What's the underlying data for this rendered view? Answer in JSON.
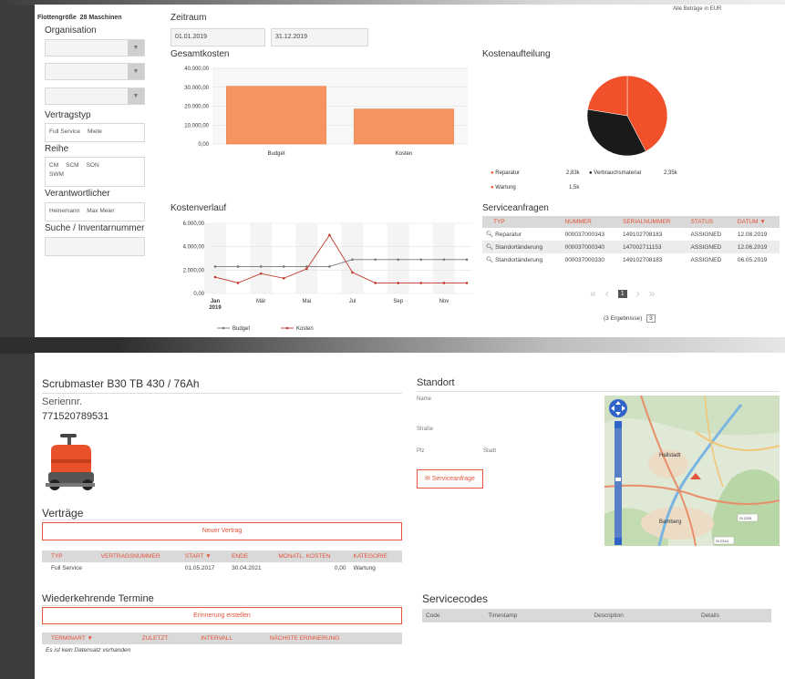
{
  "top": {
    "amounts_note": "Alle Beträge in EUR",
    "fleet_label": "Flottengröße",
    "fleet_count": "28 Maschinen",
    "organisation_label": "Organisation",
    "contract_type_label": "Vertragstyp",
    "contract_types": [
      "Full Service",
      "Miete"
    ],
    "series_label": "Reihe",
    "series": [
      "CM",
      "SCM",
      "SON",
      "SWM"
    ],
    "responsible_label": "Verantwortlicher",
    "responsible": [
      "Heinemann",
      "Max Meier"
    ],
    "search_label": "Suche / Inventarnummer",
    "period_label": "Zeitraum",
    "date_from": "01.01.2019",
    "date_to": "31.12.2019",
    "total_costs_label": "Gesamtkosten",
    "cost_split_label": "Kostenaufteilung",
    "cost_trend_label": "Kostenverlauf",
    "service_requests_label": "Serviceanfragen",
    "pie_legend": [
      {
        "name": "Reparatur",
        "value": "2,83k",
        "color": "#f0502a"
      },
      {
        "name": "Verbrauchsmaterial",
        "value": "2,35k",
        "color": "#111111"
      },
      {
        "name": "Wartung",
        "value": "1,5k",
        "color": "#f0502a"
      }
    ],
    "requests_headers": [
      "TYP",
      "NUMMER",
      "SERIALNUMMER",
      "STATUS",
      "DATUM ▼"
    ],
    "requests_rows": [
      [
        "Reparatur",
        "000037000343",
        "149102708183",
        "ASSIGNED",
        "12.08.2019"
      ],
      [
        "Standortänderung",
        "000037000340",
        "147002711153",
        "ASSIGNED",
        "12.06.2019"
      ],
      [
        "Standortänderung",
        "000037000330",
        "149102708183",
        "ASSIGNED",
        "06.05.2019"
      ]
    ],
    "pager_first": "«",
    "pager_prev": "‹",
    "pager_current": "1",
    "pager_next": "›",
    "pager_last": "»",
    "results_text": "(3 Ergebnisse)",
    "results_per_page": "3"
  },
  "bottom": {
    "machine_title": "Scrubmaster B30 TB 430 / 76Ah",
    "serial_label": "Seriennr.",
    "serial_value": "771520789531",
    "contracts_label": "Verträge",
    "new_contract_button": "Neuer Vertrag",
    "contract_headers": [
      "TYP",
      "VERTRAGSNUMMER",
      "START ▼",
      "ENDE",
      "MONATL. KOSTEN",
      "KATEGORIE"
    ],
    "contract_row": [
      "Full Service",
      "",
      "01.05.2017",
      "30.04.2021",
      "0,00",
      "Wartung"
    ],
    "recurring_label": "Wiederkehrende Termine",
    "reminder_button": "Erinnerung erstellen",
    "recurring_headers": [
      "TERMINART ▼",
      "ZULETZT",
      "INTERVALL",
      "NÄCHSTE ERINNERUNG"
    ],
    "no_records": "Es ist kein Datensatz vorhanden",
    "location_label": "Standort",
    "name_label": "Name",
    "street_label": "Straße",
    "zip_label": "Plz",
    "city_label": "Stadt",
    "service_request_button": "Serviceanfrage",
    "service_codes_label": "Servicecodes",
    "codes_headers": [
      "Code",
      "Timestamp",
      "Description",
      "Details"
    ],
    "map_labels": {
      "hallstadt": "Hallstadt",
      "bamberg": "Bamberg",
      "road1": "St 2281",
      "road2": "St 2244"
    }
  },
  "chart_data": [
    {
      "type": "bar",
      "title": "Gesamtkosten",
      "categories": [
        "Budget",
        "Kosten"
      ],
      "values": [
        30500,
        18500
      ],
      "ylim": [
        0,
        40000
      ],
      "yticks": [
        "40.000,00",
        "30.000,00",
        "20.000,00",
        "10.000,00",
        "0,00"
      ],
      "color": "#f59460"
    },
    {
      "type": "pie",
      "title": "Kostenaufteilung",
      "labels": [
        "Reparatur",
        "Verbrauchsmaterial",
        "Wartung"
      ],
      "values": [
        2830,
        2350,
        1500
      ],
      "colors": [
        "#f0502a",
        "#1a1a1a",
        "#f0502a"
      ]
    },
    {
      "type": "line",
      "title": "Kostenverlauf",
      "x": [
        "Jan 2019",
        "Feb",
        "Mär",
        "Apr",
        "Mai",
        "Jun",
        "Jul",
        "Aug",
        "Sep",
        "Okt",
        "Nov",
        "Dez"
      ],
      "xticks": [
        "Jan\n2019",
        "Mär",
        "Mai",
        "Jul",
        "Sep",
        "Nov"
      ],
      "yticks": [
        "6.000,00",
        "4.000,00",
        "2.000,00",
        "0,00"
      ],
      "ylim": [
        0,
        6000
      ],
      "series": [
        {
          "name": "Budget",
          "color": "#777777",
          "values": [
            2300,
            2300,
            2300,
            2300,
            2300,
            2300,
            2900,
            2900,
            2900,
            2900,
            2900,
            2900
          ]
        },
        {
          "name": "Kosten",
          "color": "#c0392b",
          "values": [
            1400,
            900,
            1700,
            1300,
            2100,
            5000,
            1800,
            900,
            900,
            900,
            900,
            900
          ]
        }
      ]
    }
  ]
}
